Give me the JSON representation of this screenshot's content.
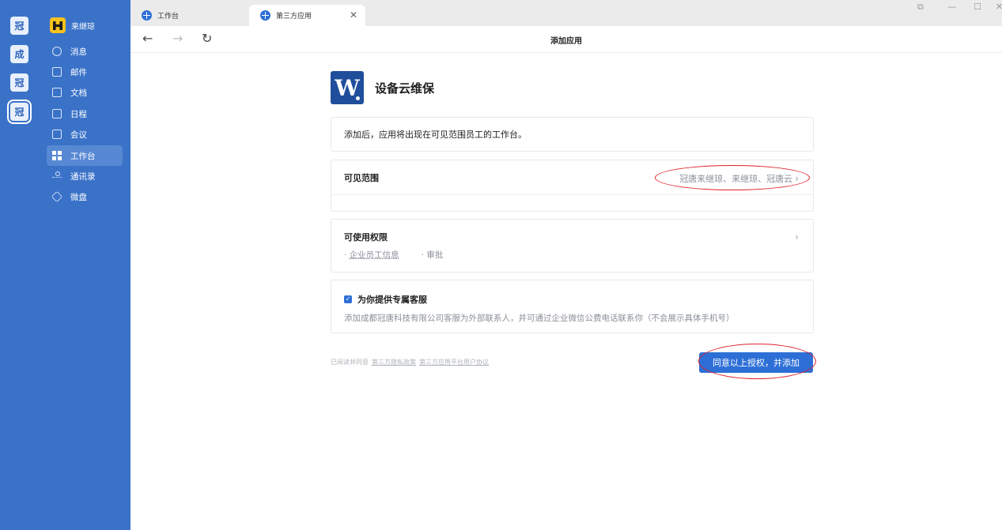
{
  "orgs": [
    "冠",
    "成",
    "冠",
    "冠"
  ],
  "user": {
    "name": "来继琼"
  },
  "nav": {
    "items": [
      {
        "label": "消息",
        "icon": "message-icon"
      },
      {
        "label": "邮件",
        "icon": "mail-icon"
      },
      {
        "label": "文档",
        "icon": "document-icon"
      },
      {
        "label": "日程",
        "icon": "calendar-icon"
      },
      {
        "label": "会议",
        "icon": "meeting-icon"
      },
      {
        "label": "工作台",
        "icon": "workbench-icon",
        "active": true
      },
      {
        "label": "通讯录",
        "icon": "contacts-icon"
      },
      {
        "label": "微盘",
        "icon": "drive-icon"
      }
    ]
  },
  "tabs": [
    {
      "label": "工作台"
    },
    {
      "label": "第三方应用",
      "active": true
    }
  ],
  "page": {
    "title": "添加应用"
  },
  "app": {
    "name": "设备云维保",
    "logo_letter": "W"
  },
  "notice": "添加后，应用将出现在可见范围员工的工作台。",
  "scope": {
    "title": "可见范围",
    "value": "冠唐来继琼、来继琼、冠唐云"
  },
  "permissions": {
    "title": "可使用权限",
    "items": [
      "企业员工信息",
      "审批"
    ]
  },
  "service": {
    "checked": true,
    "title": "为你提供专属客服",
    "description": "添加成都冠唐科技有限公司客服为外部联系人，并可通过企业微信公费电话联系你（不会展示具体手机号）"
  },
  "agreement": {
    "prefix": "已阅读并同意",
    "links": [
      "第三方隐私政策",
      "第三方应用平台用户协议"
    ]
  },
  "submit_label": "同意以上授权，并添加",
  "colors": {
    "sidebar": "#3a72c8",
    "primary": "#2d6fd6",
    "annotation": "#e1202a"
  }
}
